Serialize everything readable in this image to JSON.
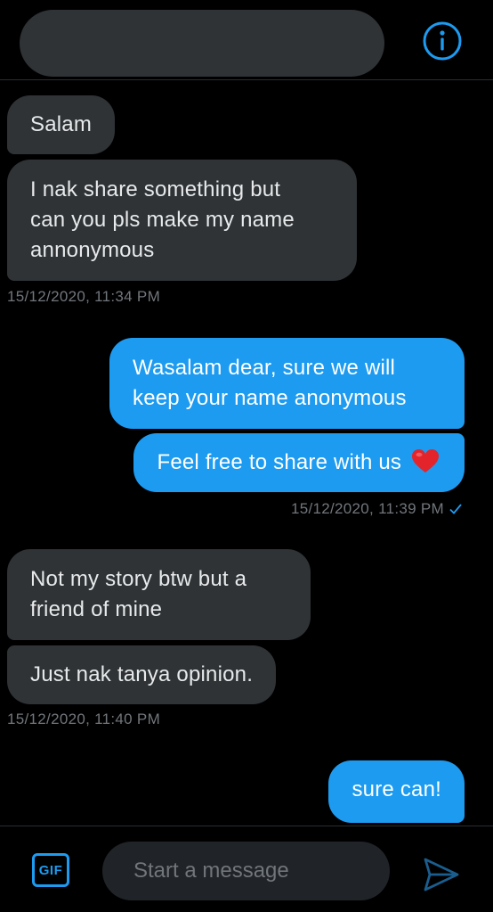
{
  "header": {
    "info_icon": "info-circle-icon"
  },
  "messages": [
    {
      "id": "m1",
      "text": "Salam"
    },
    {
      "id": "m2",
      "lines": [
        "I nak share something but",
        "can you pls make my name",
        "annonymous"
      ]
    },
    {
      "id": "t1",
      "time": "15/12/2020, 11:34 PM"
    },
    {
      "id": "m3",
      "lines": [
        "Wasalam dear, sure we will",
        "keep your name anonymous"
      ]
    },
    {
      "id": "m4",
      "text": "Feel free to share with us",
      "emoji": "red-heart"
    },
    {
      "id": "t2",
      "time": "15/12/2020, 11:39 PM",
      "status_icon": "check-icon"
    },
    {
      "id": "m5",
      "lines": [
        "Not my story btw but a",
        "friend of mine"
      ]
    },
    {
      "id": "m6",
      "text": "Just nak tanya opinion."
    },
    {
      "id": "t3",
      "time": "15/12/2020, 11:40 PM"
    },
    {
      "id": "m7",
      "text": "sure can!"
    }
  ],
  "composer": {
    "gif_label": "GIF",
    "placeholder": "Start a message",
    "send_icon": "send-icon"
  },
  "colors": {
    "accent": "#1d9bf0",
    "incoming_bubble": "#2f3336",
    "background": "#000000"
  }
}
